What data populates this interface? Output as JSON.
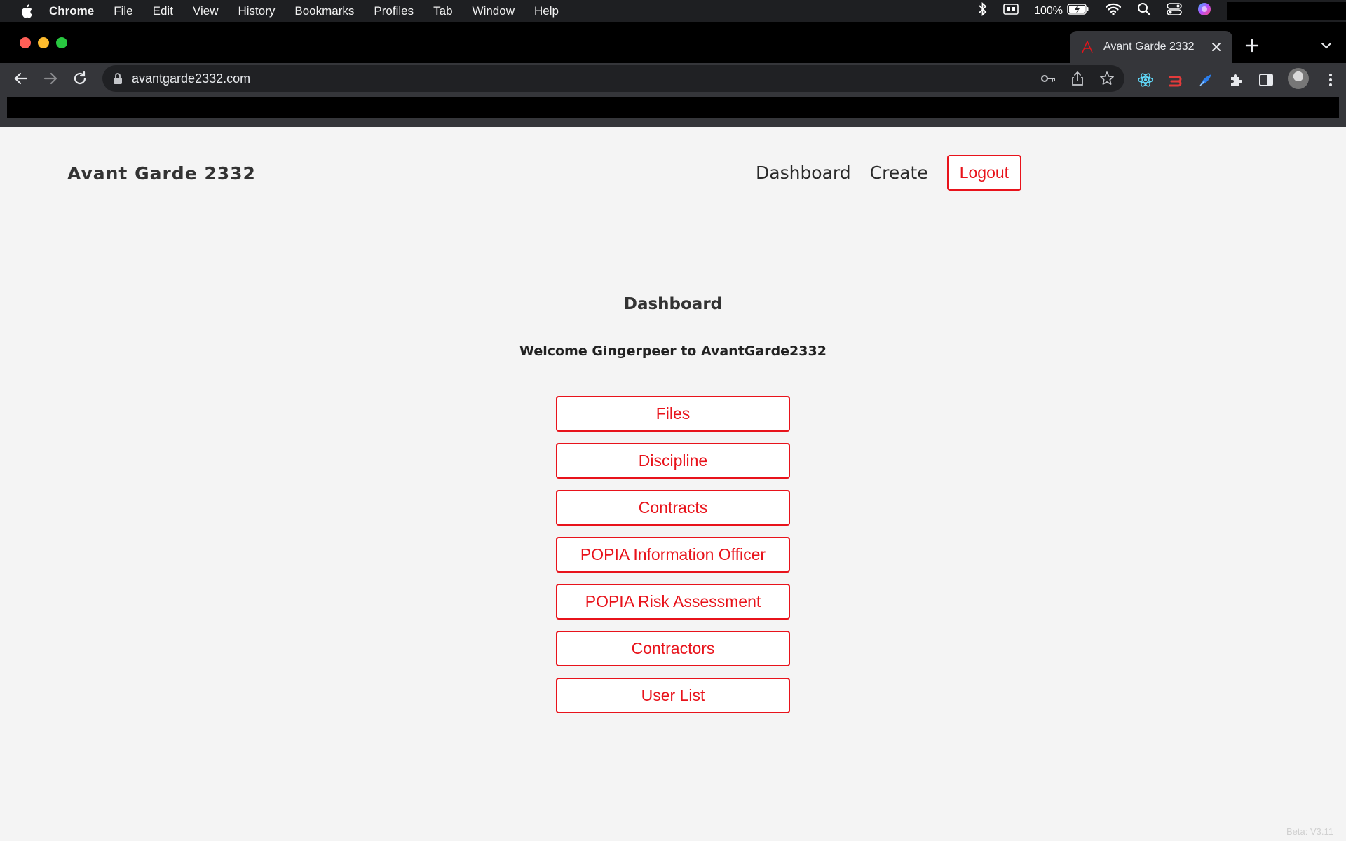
{
  "menubar": {
    "app": "Chrome",
    "items": [
      "File",
      "Edit",
      "View",
      "History",
      "Bookmarks",
      "Profiles",
      "Tab",
      "Window",
      "Help"
    ],
    "battery": "100%"
  },
  "browser": {
    "tab_title": "Avant Garde 2332",
    "url": "avantgarde2332.com"
  },
  "site": {
    "brand": "Avant Garde 2332",
    "nav": {
      "dashboard": "Dashboard",
      "create": "Create",
      "logout": "Logout"
    }
  },
  "main": {
    "title": "Dashboard",
    "welcome": "Welcome Gingerpeer to AvantGarde2332",
    "buttons": [
      "Files",
      "Discipline",
      "Contracts",
      "POPIA Information Officer",
      "POPIA Risk Assessment",
      "Contractors",
      "User List"
    ]
  },
  "footer": {
    "version": "Beta: V3.11"
  },
  "colors": {
    "accent": "#e8131b",
    "page_bg": "#f4f4f4",
    "browser_toolbar": "#35363a"
  }
}
